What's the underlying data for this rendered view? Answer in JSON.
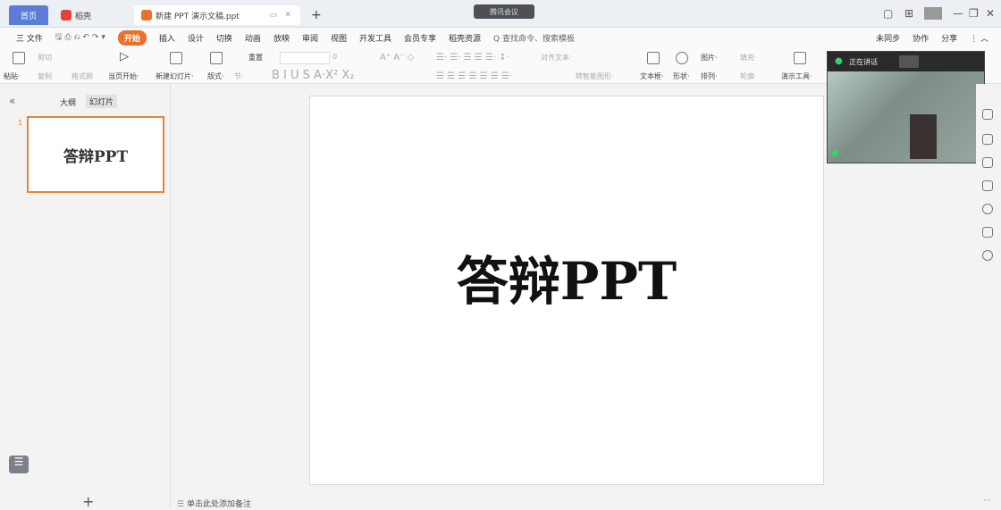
{
  "titlebar": {
    "tabs": [
      {
        "label": "首页"
      },
      {
        "label": "稻壳"
      },
      {
        "label": "新建 PPT 演示文稿.ppt"
      }
    ],
    "meeting_badge": "腾讯会议",
    "new_tab": "+"
  },
  "menubar": {
    "file": "三 文件",
    "items": [
      "开始",
      "插入",
      "设计",
      "切换",
      "动画",
      "放映",
      "审阅",
      "视图",
      "开发工具",
      "会员专享",
      "稻壳资源"
    ],
    "search": "Q 查找命令、搜索模板",
    "right": [
      "未同步",
      "协作",
      "分享"
    ]
  },
  "toolbar": {
    "paste": "粘贴·",
    "cut": "剪切",
    "copy": "复制",
    "format_painter": "格式刷",
    "play_from_current": "当页开始·",
    "new_slide": "新建幻灯片·",
    "layout": "版式·",
    "section": "节·",
    "reset": "重置",
    "font_size": "0",
    "align_text": "对齐文本·",
    "smart_art": "转智能图形·",
    "textbox": "文本框·",
    "shape": "形状·",
    "picture": "图片·",
    "arrange": "排列·",
    "fill": "填充·",
    "outline": "轮廓·",
    "presentation_tools": "演示工具·"
  },
  "leftpanel": {
    "tab_outline": "大纲",
    "tab_slides": "幻灯片",
    "slide_number": "1",
    "thumb_title": "答辩PPT",
    "add": "+"
  },
  "slide": {
    "title": "答辩PPT"
  },
  "video": {
    "status": "正在讲话"
  },
  "notes": "单击此处添加备注"
}
